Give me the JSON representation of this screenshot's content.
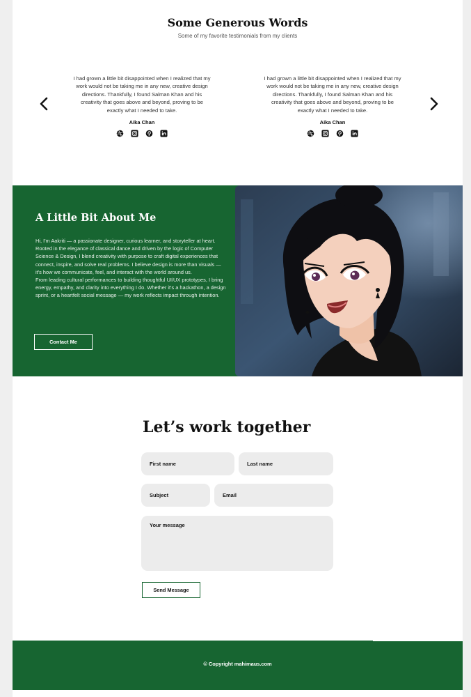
{
  "testimonials": {
    "title": "Some Generous Words",
    "subtitle": "Some of my favorite testimonials from my clients",
    "items": [
      {
        "quote": "I had grown a little bit disappointed when I realized that my work would not be taking me in any new, creative design directions. Thankfully, I found Salman Khan and his creativity that goes above and beyond, proving to be exactly what I needed to take.",
        "author": "Aika Chan"
      },
      {
        "quote": "I had grown a little bit disappointed when I realized that my work would not be taking me in any new, creative design directions. Thankfully, I found Salman Khan and his creativity that goes above and beyond, proving to be exactly what I needed to take.",
        "author": "Aika Chan"
      }
    ],
    "social_icons": [
      "dribbble-icon",
      "instagram-icon",
      "pinterest-icon",
      "linkedin-icon"
    ]
  },
  "about": {
    "title": "A Little Bit About Me",
    "paragraphs": [
      "Hi, I'm Aakriti — a passionate designer, curious learner, and storyteller at heart.",
      "Rooted in the elegance of classical dance and driven by the logic of Computer Science & Design, I blend creativity with purpose to craft digital experiences that connect, inspire, and solve real problems. I believe design is more than visuals — it's how we communicate, feel, and interact with the world around us.",
      "From leading cultural performances to building thoughtful UI/UX prototypes, I bring energy, empathy, and clarity into everything I do. Whether it's a hackathon, a design sprint, or a heartfelt social message — my work reflects impact through intention."
    ],
    "button": "Contact Me"
  },
  "contact": {
    "title": "Let’s work together",
    "first_name_placeholder": "First name",
    "last_name_placeholder": "Last name",
    "subject_placeholder": "Subject",
    "email_placeholder": "Email",
    "message_placeholder": "Your message",
    "button": "Send Message"
  },
  "footer": {
    "copyright": "© Copyright mahimaus.com"
  },
  "colors": {
    "brand_green": "#176531",
    "field_bg": "#ececec",
    "page_bg": "#efefef"
  }
}
